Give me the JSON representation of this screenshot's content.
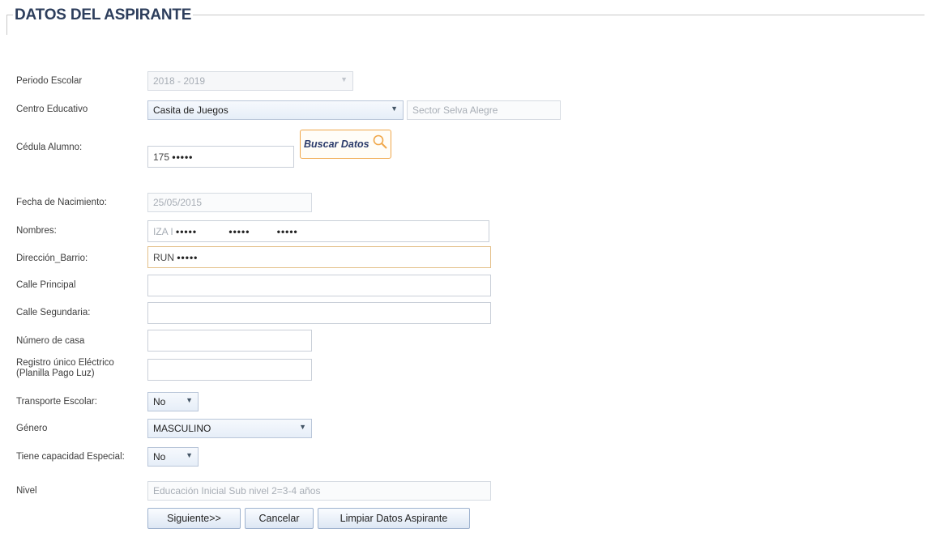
{
  "form": {
    "title": "DATOS DEL ASPIRANTE",
    "periodo": {
      "label": "Periodo Escolar",
      "value": "2018 - 2019"
    },
    "centro": {
      "label": "Centro Educativo",
      "value": "Casita de Juegos",
      "sector": "Sector Selva Alegre"
    },
    "cedula": {
      "label": "Cédula Alumno:",
      "value_prefix": "175",
      "masked": "•••••"
    },
    "buscar_label": "Buscar Datos",
    "fecha": {
      "label": "Fecha de Nacimiento:",
      "value": "25/05/2015"
    },
    "nombres": {
      "label": "Nombres:",
      "value_prefix": "IZA I",
      "masked1": "•••••",
      "masked2": "•••••",
      "masked3": "•••••"
    },
    "direccion": {
      "label": "Dirección_Barrio:",
      "value_prefix": "RUN",
      "masked": "•••••"
    },
    "calle_principal": {
      "label": "Calle Principal",
      "value": ""
    },
    "calle_secundaria": {
      "label": "Calle Segundaria:",
      "value": ""
    },
    "numero_casa": {
      "label": "Número de casa",
      "value": ""
    },
    "registro": {
      "label_line1": "Registro único Eléctrico",
      "label_line2": "(Planilla Pago Luz)",
      "value": ""
    },
    "transporte": {
      "label": "Transporte Escolar:",
      "value": "No"
    },
    "genero": {
      "label": "Género",
      "value": "MASCULINO"
    },
    "capacidad": {
      "label": "Tiene capacidad Especial:",
      "value": "No"
    },
    "nivel": {
      "label": "Nivel",
      "value": "Educación Inicial Sub nivel 2=3-4 años"
    }
  },
  "buttons": {
    "siguiente": "Siguiente>>",
    "cancelar": "Cancelar",
    "limpiar": "Limpiar Datos Aspirante"
  },
  "icons": {
    "dropdown": "chevron-down-icon",
    "search": "search-icon"
  },
  "colors": {
    "title": "#2d3e5c",
    "buscar_border": "#f0a74a",
    "input_border": "#c9cfd8"
  }
}
